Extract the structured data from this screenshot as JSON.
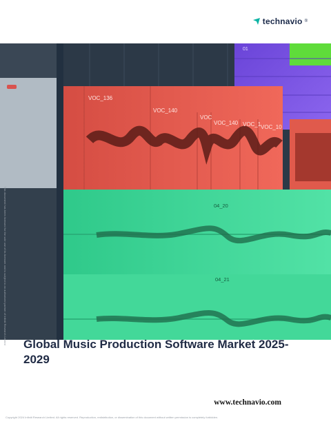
{
  "brand": {
    "name": "technavio",
    "registered": "®",
    "color": "#1b2a4a",
    "mark_color": "#0bb3a4"
  },
  "hero": {
    "description_icon": "audio-waveform-daw",
    "track_labels": [
      "VOC_136",
      "VOC_140",
      "VOC",
      "VOC_140",
      "VOC_1",
      "VOC_10",
      "04_20",
      "04_21",
      "01"
    ],
    "colors": {
      "red": "#e05a4c",
      "green": "#3ed79a",
      "purple": "#7b55e8",
      "lime": "#5fdc3a",
      "dark": "#2f3d4a"
    }
  },
  "report": {
    "title": "Global Music Production Software Market 2025-2029"
  },
  "footer": {
    "website": "www.technavio.com",
    "copyright": "Copyright 2024 Infiniti Research Limited. All rights reserved. Reproduction, redistribution, or dissemination of this document without written permission is completely forbidden.",
    "side_note": "This document has been licensed for the sole use of its licensee and is subject to an authorized partner of Infiniti Research Limited"
  }
}
